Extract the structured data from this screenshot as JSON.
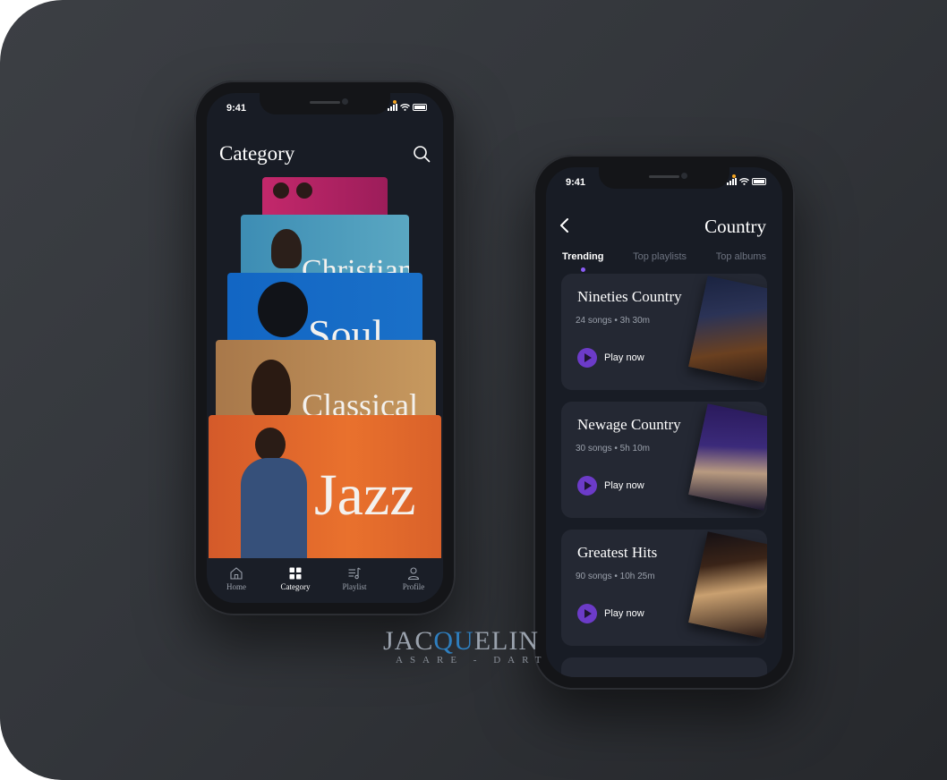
{
  "left_phone": {
    "time": "9:41",
    "title": "Category",
    "genres": [
      {
        "label": "",
        "color": "#a6205e"
      },
      {
        "label": "Christian",
        "color": "#4a97b8"
      },
      {
        "label": "Soul",
        "color": "#1565c0"
      },
      {
        "label": "Classical",
        "color": "#b3834c"
      },
      {
        "label": "Jazz",
        "color": "#e0622c"
      }
    ],
    "nav": [
      {
        "label": "Home",
        "icon": "home-icon"
      },
      {
        "label": "Category",
        "icon": "grid-icon"
      },
      {
        "label": "Playlist",
        "icon": "playlist-icon"
      },
      {
        "label": "Profile",
        "icon": "profile-icon"
      }
    ]
  },
  "right_phone": {
    "time": "9:41",
    "title": "Country",
    "tabs": [
      "Trending",
      "Top playlists",
      "Top albums"
    ],
    "playlists": [
      {
        "title": "Nineties Country",
        "meta": "24 songs • 3h 30m",
        "action": "Play now"
      },
      {
        "title": "Newage Country",
        "meta": "30 songs • 5h 10m",
        "action": "Play now"
      },
      {
        "title": "Greatest Hits",
        "meta": "90 songs • 10h 25m",
        "action": "Play now"
      }
    ]
  },
  "watermark": {
    "line1a": "JAC",
    "line1b": "QU",
    "line1c": "ELIN",
    "line2": "ASARE - DART"
  },
  "colors": {
    "accent": "#8b5cf6",
    "play": "#6c3bc8",
    "card_bg": "#242833",
    "screen_bg": "#181c25"
  }
}
